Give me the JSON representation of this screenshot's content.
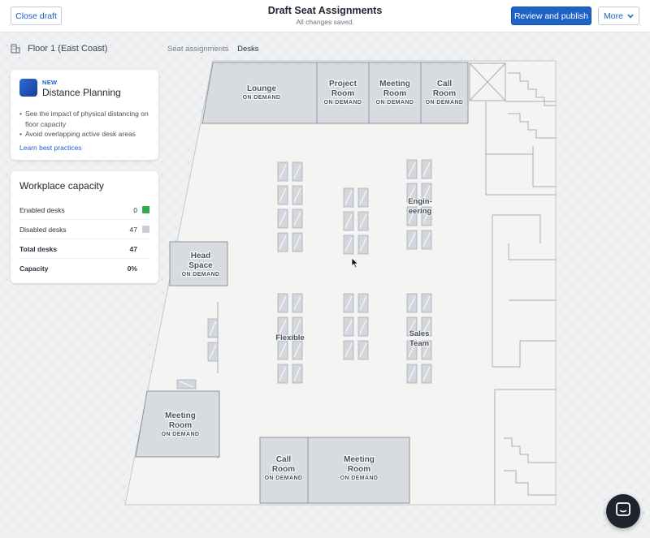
{
  "header": {
    "close_label": "Close draft",
    "title": "Draft Seat Assignments",
    "subtitle": "All changes saved.",
    "publish_label": "Review and publish",
    "more_label": "More"
  },
  "floor": {
    "name": "Floor 1 (East Coast)"
  },
  "breadcrumb": {
    "parent": "Seat assignments",
    "current": "Desks"
  },
  "distance_card": {
    "badge": "NEW",
    "title": "Distance Planning",
    "bullets": [
      "See the impact of physical distancing on floor capacity",
      "Avoid overlapping active desk areas"
    ],
    "link": "Learn best practices"
  },
  "capacity_card": {
    "title": "Workplace capacity",
    "rows": [
      {
        "label": "Enabled desks",
        "value": "0",
        "swatch": "#2eaa4f"
      },
      {
        "label": "Disabled desks",
        "value": "47",
        "swatch": "#c9ced6"
      },
      {
        "label": "Total desks",
        "value": "47"
      },
      {
        "label": "Capacity",
        "value": "0%"
      }
    ]
  },
  "rooms": [
    {
      "name": "Lounge",
      "tag": "ON DEMAND"
    },
    {
      "name": "Project Room",
      "tag": "ON DEMAND"
    },
    {
      "name": "Meeting Room",
      "tag": "ON DEMAND"
    },
    {
      "name": "Call Room",
      "tag": "ON DEMAND"
    },
    {
      "name": "Head Space",
      "tag": "ON DEMAND"
    },
    {
      "name": "Meeting Room",
      "tag": "ON DEMAND"
    },
    {
      "name": "Call Room",
      "tag": "ON DEMAND"
    },
    {
      "name": "Meeting Room",
      "tag": "ON DEMAND"
    }
  ],
  "neighborhoods": [
    "Engineering",
    "Flexible",
    "Sales Team"
  ],
  "colors": {
    "accent": "#1f62c6",
    "floor": "#f4f4f2",
    "room": "#d8dce1",
    "desk": "#d3d7dd"
  }
}
